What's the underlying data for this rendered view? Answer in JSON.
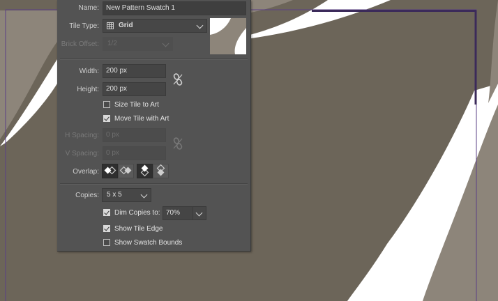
{
  "dialog": {
    "name_label": "Name:",
    "name_value": "New Pattern Swatch 1",
    "tile_type_label": "Tile Type:",
    "tile_type_value": "Grid",
    "brick_offset_label": "Brick Offset:",
    "brick_offset_value": "1/2",
    "width_label": "Width:",
    "width_value": "200 px",
    "height_label": "Height:",
    "height_value": "200 px",
    "size_tile_to_art": {
      "label": "Size Tile to Art",
      "checked": false
    },
    "move_tile_with_art": {
      "label": "Move Tile with Art",
      "checked": true
    },
    "h_spacing_label": "H Spacing:",
    "h_spacing_value": "0 px",
    "v_spacing_label": "V Spacing:",
    "v_spacing_value": "0 px",
    "overlap_label": "Overlap:",
    "copies_label": "Copies:",
    "copies_value": "5 x 5",
    "dim_copies": {
      "label": "Dim Copies to:",
      "checked": true,
      "value": "70%"
    },
    "show_tile_edge": {
      "label": "Show Tile Edge",
      "checked": true
    },
    "show_swatch_bounds": {
      "label": "Show Swatch Bounds",
      "checked": false
    }
  },
  "colors": {
    "canvas_brown": "#6c6559",
    "canvas_light": "#8d857a",
    "white_shape": "#ffffff",
    "tile_edge": "#5a3f86",
    "panel_bg": "#535353"
  },
  "icons": [
    "grid-icon",
    "chain-link-icon",
    "overlap-left-in-front-icon",
    "overlap-right-in-front-icon",
    "overlap-top-in-front-icon",
    "overlap-bottom-in-front-icon"
  ]
}
